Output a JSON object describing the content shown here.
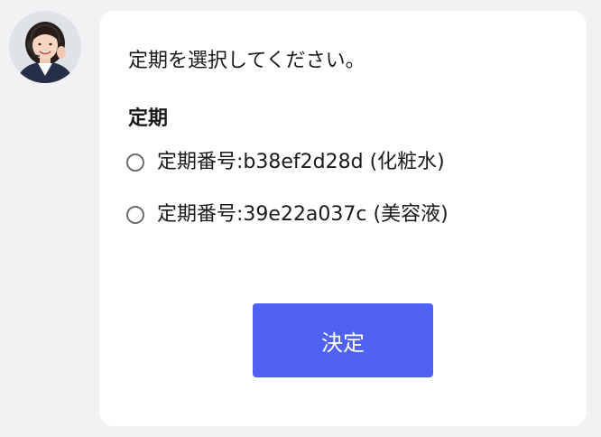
{
  "chat": {
    "avatar_icon": "support-agent-avatar",
    "message": {
      "prompt": "定期を選択してください。",
      "section_title": "定期",
      "options": [
        {
          "label": "定期番号:b38ef2d28d (化粧水)",
          "selected": false
        },
        {
          "label": "定期番号:39e22a037c (美容液)",
          "selected": false
        }
      ],
      "submit_label": "決定"
    }
  },
  "colors": {
    "page_background": "#f2f2f5",
    "bubble_background": "#ffffff",
    "submit_button": "#4f62f3",
    "radio_border": "#6e6e6e"
  }
}
